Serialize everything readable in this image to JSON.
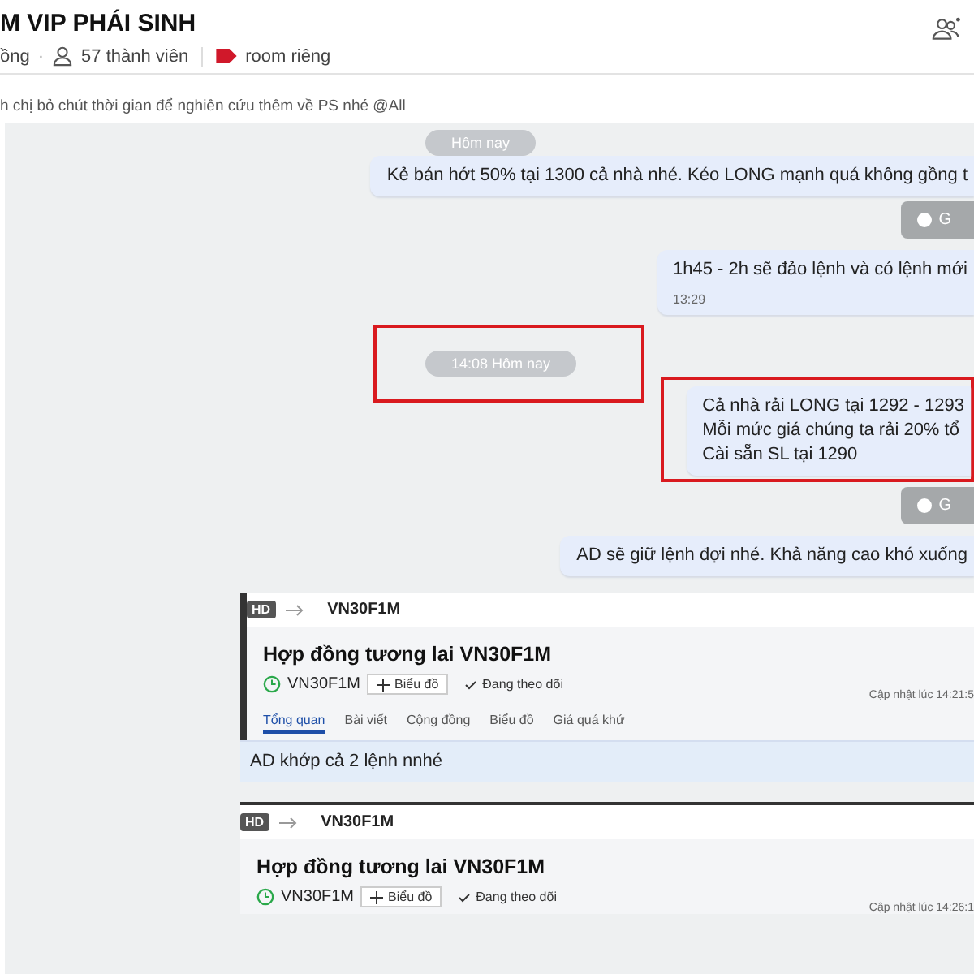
{
  "header": {
    "title": "M VIP PHÁI SINH",
    "status": "ồng",
    "separator": "·",
    "members": "57 thành viên",
    "tag": "room riêng"
  },
  "pinned_message": "h chị bỏ chút thời gian để nghiên cứu thêm về PS nhé @All",
  "messages": [
    {
      "kind": "date",
      "text": "Hôm nay",
      "highlighted": false
    },
    {
      "kind": "text",
      "lines": [
        "Kẻ bán hớt 50% tại 1300 cả nhà nhé. Kéo LONG mạnh quá không gồng t"
      ],
      "highlighted": false
    },
    {
      "kind": "action",
      "text": "G"
    },
    {
      "kind": "text",
      "lines": [
        "1h45 - 2h sẽ đảo lệnh và có lệnh mới"
      ],
      "time": "13:29",
      "highlighted": false
    },
    {
      "kind": "date",
      "text": "14:08 Hôm nay",
      "highlighted": true
    },
    {
      "kind": "text",
      "lines": [
        "Cả nhà rải LONG tại 1292 - 1293",
        "Mỗi mức giá chúng ta rải 20% tổ",
        "Cài sẵn SL tại 1290"
      ],
      "highlighted": true
    },
    {
      "kind": "action",
      "text": "G"
    },
    {
      "kind": "text",
      "lines": [
        "AD sẽ giữ lệnh đợi nhé. Khả năng cao khó xuống"
      ],
      "highlighted": false
    },
    {
      "kind": "card",
      "badge": "HD",
      "symbol": "VN30F1M",
      "title": "Hợp đồng tương lai VN30F1M",
      "ticker": "VN30F1M",
      "chart_button": "Biểu đồ",
      "follow": "Đang theo dõi",
      "updated": "Cập nhật lúc 14:21:5",
      "tabs": [
        {
          "label": "Tổng quan",
          "selected": true
        },
        {
          "label": "Bài viết",
          "selected": false
        },
        {
          "label": "Cộng đồng",
          "selected": false
        },
        {
          "label": "Biểu đồ",
          "selected": false
        },
        {
          "label": "Giá quá khứ",
          "selected": false
        }
      ],
      "caption": "AD khớp cả 2 lệnh nnhé"
    },
    {
      "kind": "card",
      "badge": "HD",
      "symbol": "VN30F1M",
      "title": "Hợp đồng tương lai VN30F1M",
      "ticker": "VN30F1M",
      "chart_button": "Biểu đồ",
      "follow": "Đang theo dõi",
      "updated": "Cập nhật lúc 14:26:1"
    }
  ]
}
